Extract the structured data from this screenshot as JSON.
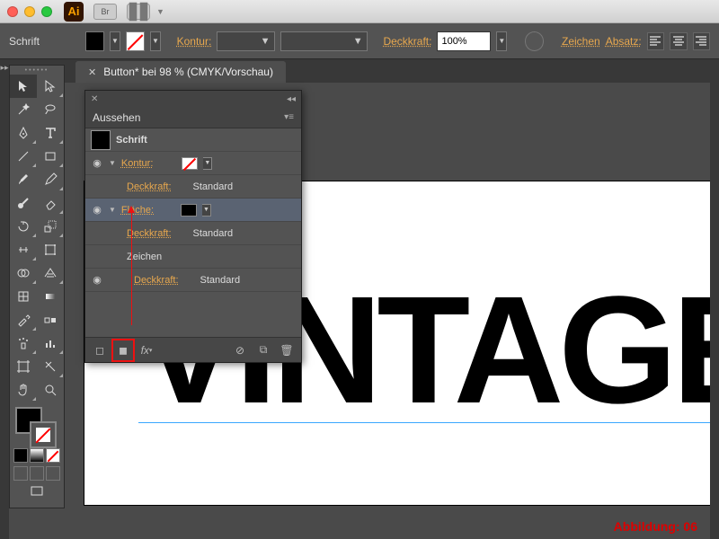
{
  "app": {
    "short": "Ai",
    "bridge": "Br"
  },
  "ctrl": {
    "context": "Schrift",
    "stroke_label": "Kontur:",
    "opacity_label": "Deckkraft:",
    "opacity_value": "100%",
    "char_link": "Zeichen",
    "para_link": "Absatz:"
  },
  "doc": {
    "tab": "Button* bei 98 % (CMYK/Vorschau)"
  },
  "panel": {
    "title": "Aussehen",
    "rows": {
      "type_label": "Schrift",
      "stroke": "Kontur:",
      "opacity": "Deckkraft:",
      "std": "Standard",
      "fill": "Fläche:",
      "chars": "Zeichen"
    }
  },
  "canvas": {
    "text": "VINTAGE"
  },
  "caption": "Abbildung: 06"
}
